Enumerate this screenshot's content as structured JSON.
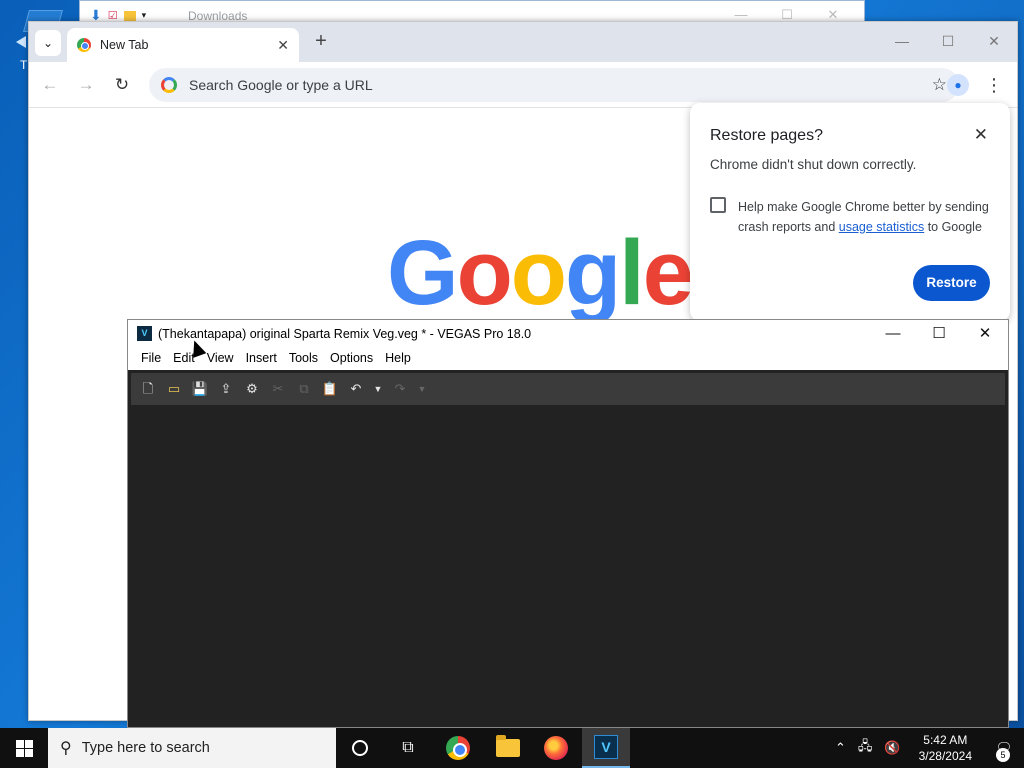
{
  "desktop": {
    "icon_label": "Th"
  },
  "explorer": {
    "title": "Downloads",
    "controls": [
      "—",
      "☐",
      "✕"
    ]
  },
  "chrome": {
    "tab": {
      "title": "New Tab",
      "close": "✕"
    },
    "new_tab": "+",
    "controls": [
      "—",
      "☐",
      "✕"
    ],
    "nav": {
      "back": "←",
      "forward": "→",
      "reload": "↻"
    },
    "omnibox": {
      "placeholder": "Search Google or type a URL",
      "star": "☆"
    },
    "menu": "⋮",
    "logo_letters": [
      {
        "ch": "G",
        "color": "#4285f4"
      },
      {
        "ch": "o",
        "color": "#ea4335"
      },
      {
        "ch": "o",
        "color": "#fbbc05"
      },
      {
        "ch": "g",
        "color": "#4285f4"
      },
      {
        "ch": "l",
        "color": "#34a853"
      },
      {
        "ch": "e",
        "color": "#ea4335"
      }
    ],
    "restore": {
      "title": "Restore pages?",
      "message": "Chrome didn't shut down correctly.",
      "help_before": "Help make Google Chrome better by sending crash reports and ",
      "help_link": "usage statistics",
      "help_after": " to Google",
      "button": "Restore"
    }
  },
  "vegas": {
    "title": "(Thekantapapa) original Sparta Remix Veg.veg * - VEGAS Pro 18.0",
    "logo": "V",
    "controls": [
      "—",
      "☐",
      "✕"
    ],
    "menu": [
      "File",
      "Edit",
      "View",
      "Insert",
      "Tools",
      "Options",
      "Help"
    ]
  },
  "taskbar": {
    "search_placeholder": "Type here to search",
    "time": "5:42 AM",
    "date": "3/28/2024",
    "notification_count": "5",
    "vegas_icon": "V"
  },
  "colors": {
    "accent": "#0b57d0",
    "vegas_bg": "#222222",
    "taskbar": "#101010"
  }
}
